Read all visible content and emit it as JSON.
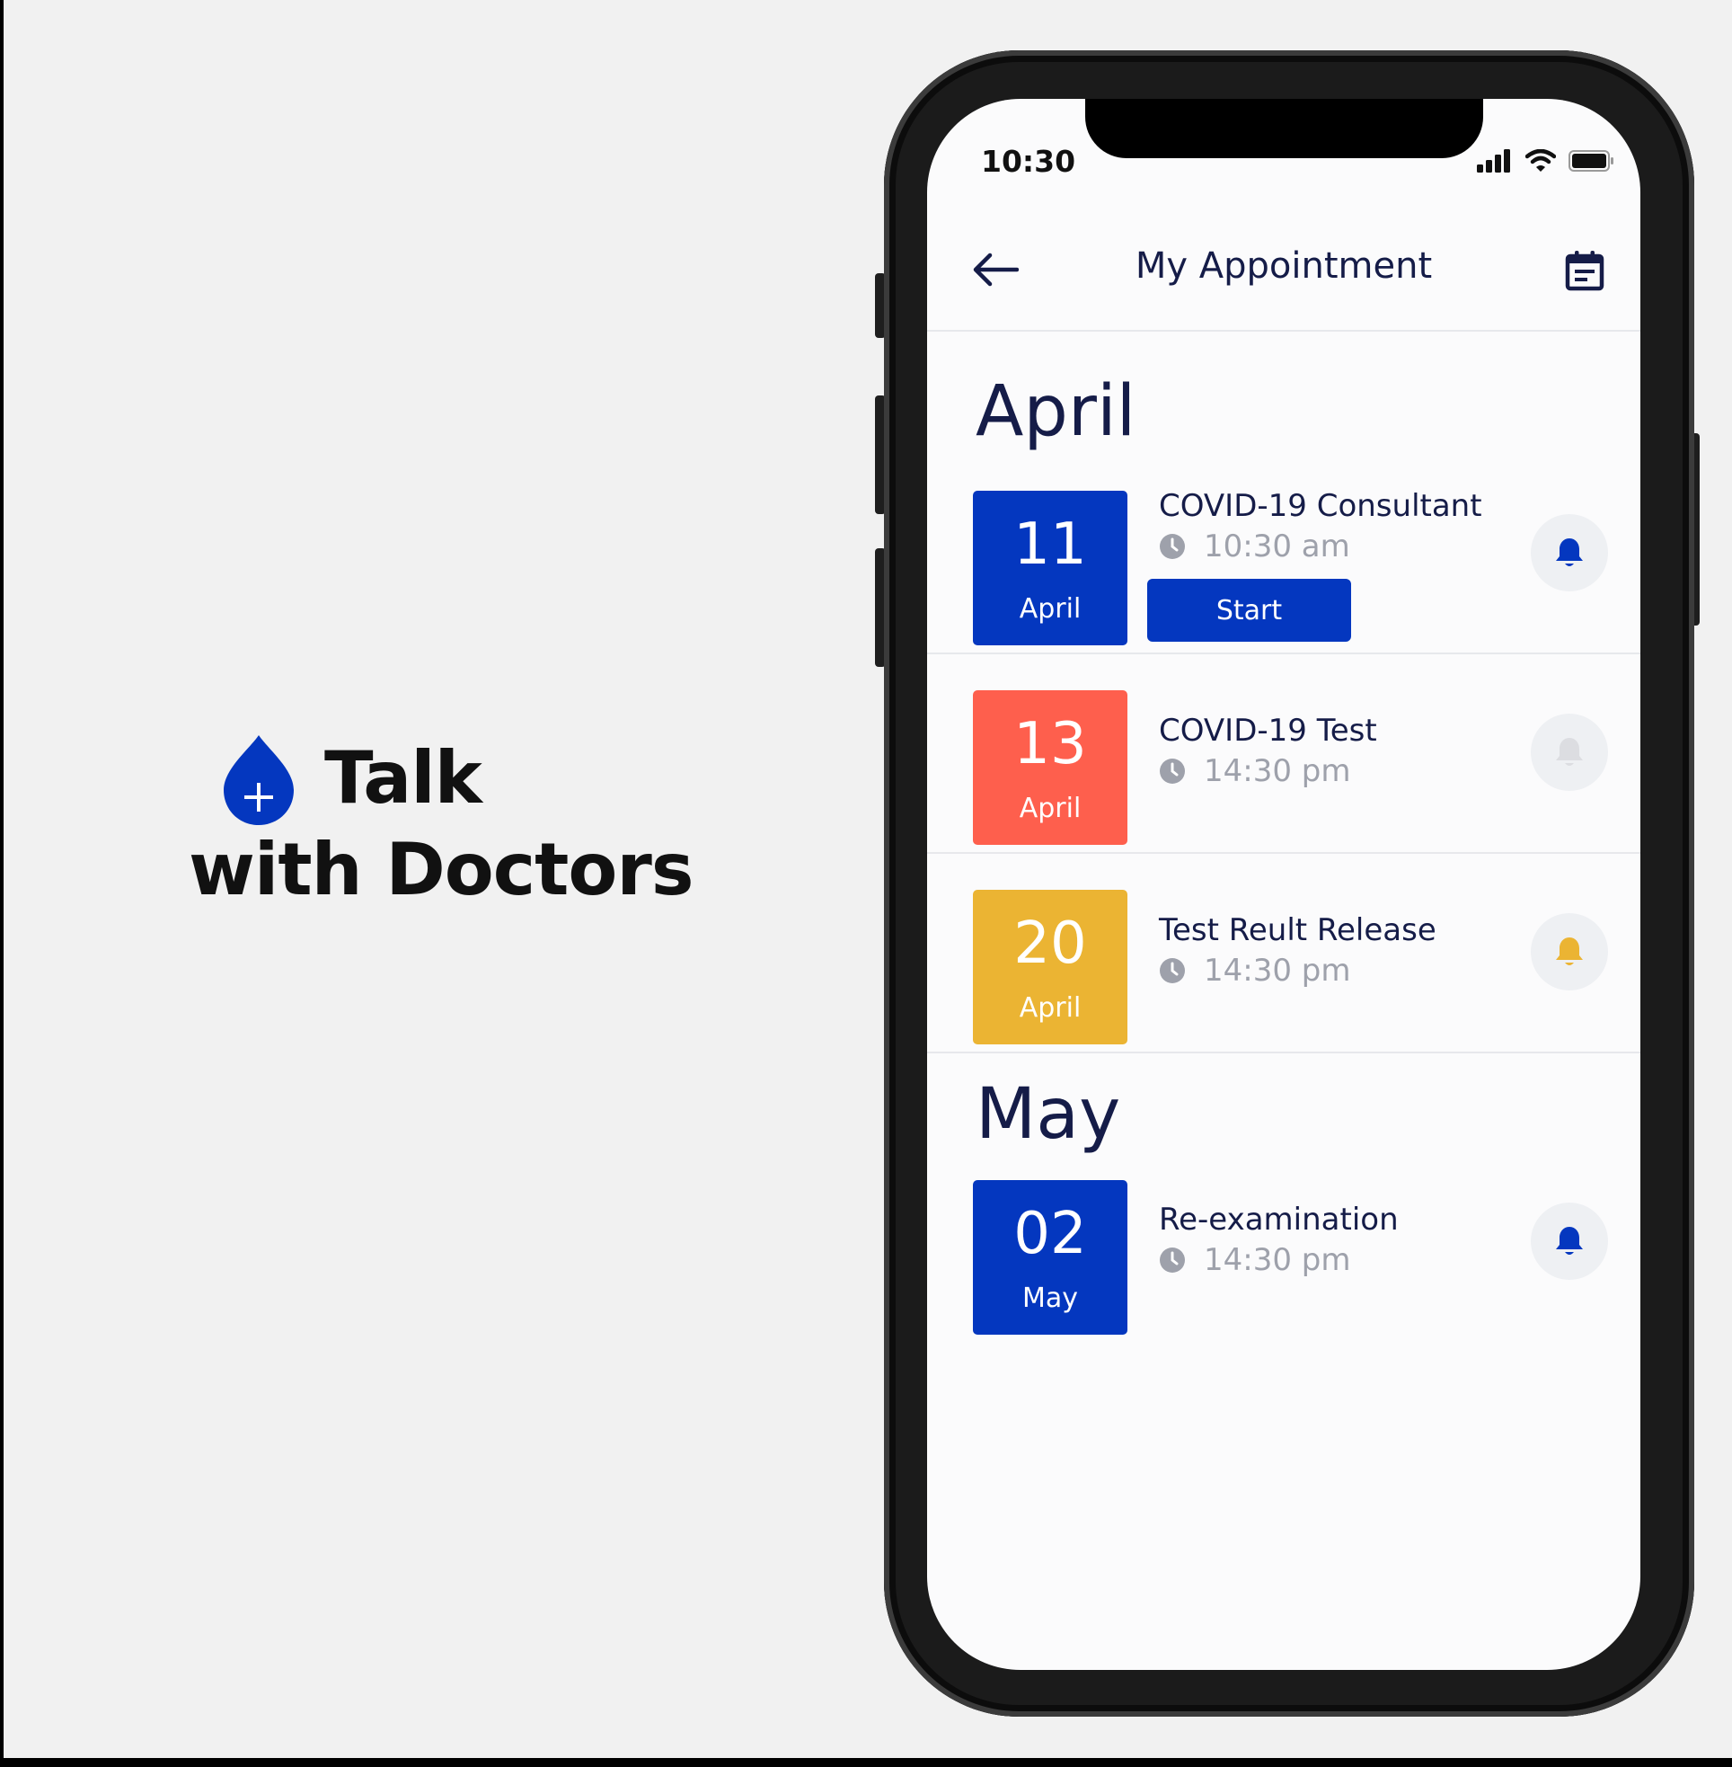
{
  "hero": {
    "logo_icon": "plus-drop-icon",
    "line1": "Talk",
    "line2": "with Doctors",
    "brand_color": "#0437bf"
  },
  "status_bar": {
    "time": "10:30",
    "icons": [
      "signal-icon",
      "wifi-icon",
      "battery-icon"
    ]
  },
  "header": {
    "back_icon": "arrow-left-icon",
    "title": "My Appointment",
    "calendar_icon": "calendar-icon"
  },
  "sections": [
    {
      "month": "April",
      "appointments": [
        {
          "day": "11",
          "month": "April",
          "title": "COVID-19 Consultant",
          "time": "10:30 am",
          "color": "#0437bf",
          "action_label": "Start",
          "bell_color": "#0437bf"
        },
        {
          "day": "13",
          "month": "April",
          "title": "COVID-19 Test",
          "time": "14:30 pm",
          "color": "#fe5f4d",
          "bell_color": "#e3e4e7"
        },
        {
          "day": "20",
          "month": "April",
          "title": "Test Reult Release",
          "time": "14:30 pm",
          "color": "#ebb433",
          "bell_color": "#ebb433"
        }
      ]
    },
    {
      "month": "May",
      "appointments": [
        {
          "day": "02",
          "month": "May",
          "title": "Re-examination",
          "time": "14:30 pm",
          "color": "#0437bf",
          "bell_color": "#0437bf"
        }
      ]
    }
  ]
}
